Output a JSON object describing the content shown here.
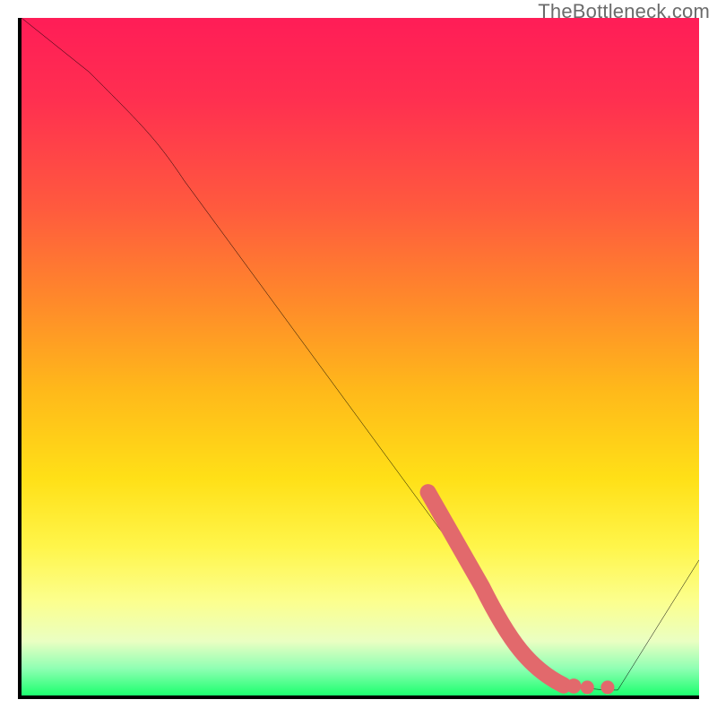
{
  "watermark": {
    "text": "TheBottleneck.com"
  },
  "chart_data": {
    "type": "line",
    "title": "",
    "xlabel": "",
    "ylabel": "",
    "xlim": [
      0,
      100
    ],
    "ylim": [
      0,
      100
    ],
    "grid": false,
    "legend": false,
    "series": [
      {
        "name": "bottleneck-curve",
        "color": "#000000",
        "x": [
          0,
          10,
          20,
          30,
          40,
          50,
          60,
          68,
          75,
          82,
          88,
          100
        ],
        "y": [
          100,
          92,
          84,
          72,
          58,
          44,
          30,
          16,
          5,
          1,
          1,
          20
        ]
      },
      {
        "name": "match-zone",
        "color": "#e2696c",
        "x": [
          60,
          68,
          75,
          80,
          84,
          86
        ],
        "y": [
          30,
          16,
          5,
          2,
          1,
          1
        ]
      }
    ],
    "background": {
      "type": "vertical-gradient",
      "stops": [
        {
          "pct": 0,
          "color": "#ff1d57"
        },
        {
          "pct": 100,
          "color": "#1cff6e"
        }
      ]
    }
  }
}
